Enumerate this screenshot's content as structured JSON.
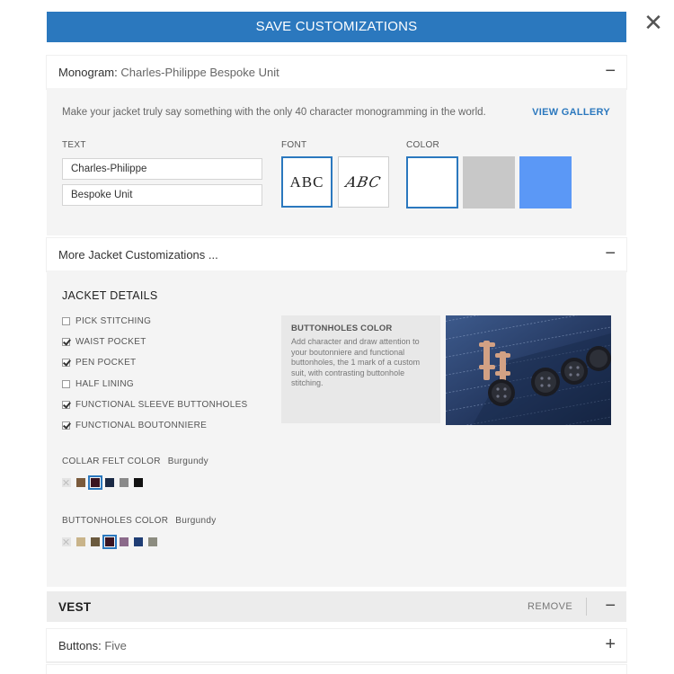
{
  "save_label": "SAVE CUSTOMIZATIONS",
  "close_glyph": "✕",
  "monogram": {
    "header_key": "Monogram:",
    "header_value": "Charles-Philippe Bespoke Unit",
    "toggle": "−",
    "intro": "Make your jacket truly say something with the only 40 character monogramming in the world.",
    "gallery_link": "VIEW GALLERY",
    "text_label": "TEXT",
    "line1": "Charles-Philippe",
    "line2": "Bespoke Unit",
    "font_label": "FONT",
    "fonts": [
      {
        "sample": "ABC",
        "style": "serif",
        "selected": true
      },
      {
        "sample": "ABC",
        "style": "script",
        "selected": false
      }
    ],
    "color_label": "COLOR",
    "colors": [
      {
        "hex": "#ffffff",
        "selected": true
      },
      {
        "hex": "#c8c8c8",
        "selected": false
      },
      {
        "hex": "#5b98f6",
        "selected": false
      }
    ]
  },
  "more": {
    "header": "More Jacket Customizations ...",
    "toggle": "−",
    "section_title": "JACKET DETAILS",
    "options": [
      {
        "label": "PICK STITCHING",
        "checked": false
      },
      {
        "label": "WAIST POCKET",
        "checked": true
      },
      {
        "label": "PEN POCKET",
        "checked": true
      },
      {
        "label": "HALF LINING",
        "checked": false
      },
      {
        "label": "FUNCTIONAL SLEEVE BUTTONHOLES",
        "checked": true
      },
      {
        "label": "FUNCTIONAL BOUTONNIERE",
        "checked": true
      }
    ],
    "info_title": "BUTTONHOLES COLOR",
    "info_desc": "Add character and draw attention to your boutonniere and functional buttonholes, the 1 mark of a custom suit, with contrasting buttonhole stitching.",
    "collar": {
      "label": "COLLAR FELT COLOR",
      "chosen": "Burgundy",
      "swatches": [
        {
          "hex": "none",
          "selected": false
        },
        {
          "hex": "#7a5a3c",
          "selected": false
        },
        {
          "hex": "#3a1420",
          "selected": true
        },
        {
          "hex": "#1b2a45",
          "selected": false
        },
        {
          "hex": "#8a8a8a",
          "selected": false
        },
        {
          "hex": "#111111",
          "selected": false
        }
      ]
    },
    "buttonholes": {
      "label": "BUTTONHOLES COLOR",
      "chosen": "Burgundy",
      "swatches": [
        {
          "hex": "none",
          "selected": false
        },
        {
          "hex": "#c9b48a",
          "selected": false
        },
        {
          "hex": "#6b5a3e",
          "selected": false
        },
        {
          "hex": "#3a1420",
          "selected": true
        },
        {
          "hex": "#8b6a8a",
          "selected": false
        },
        {
          "hex": "#1f3d74",
          "selected": false
        },
        {
          "hex": "#8c8c80",
          "selected": false
        }
      ]
    }
  },
  "vest": {
    "label": "VEST",
    "remove": "REMOVE",
    "toggle": "−"
  },
  "buttons": {
    "key": "Buttons:",
    "value": "Five",
    "toggle": "+"
  },
  "colors": {
    "accent": "#2b78be"
  }
}
